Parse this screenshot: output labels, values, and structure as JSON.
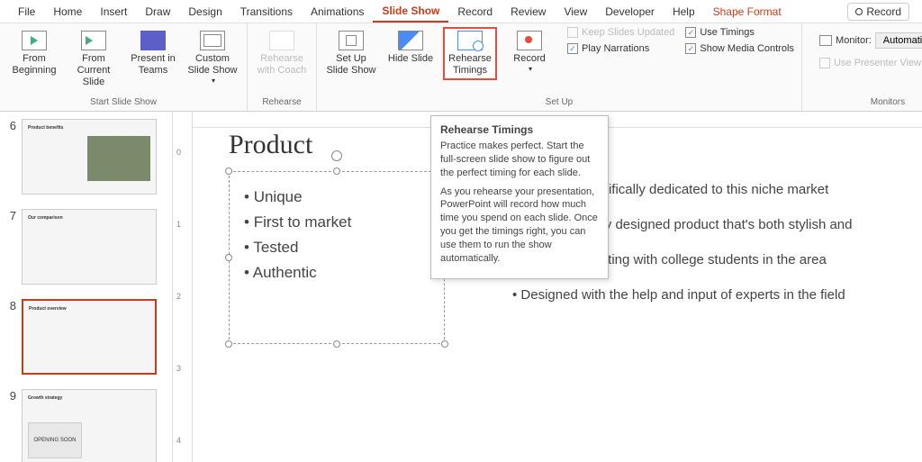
{
  "menu": {
    "tabs": [
      "File",
      "Home",
      "Insert",
      "Draw",
      "Design",
      "Transitions",
      "Animations",
      "Slide Show",
      "Record",
      "Review",
      "View",
      "Developer",
      "Help",
      "Shape Format"
    ],
    "active": "Slide Show",
    "record": "Record"
  },
  "ribbon": {
    "groups": {
      "start": {
        "label": "Start Slide Show"
      },
      "rehearse_grp": {
        "label": "Rehearse"
      },
      "setup": {
        "label": "Set Up"
      },
      "monitors": {
        "label": "Monitors"
      }
    },
    "buttons": {
      "from_beginning": "From Beginning",
      "from_current": "From Current Slide",
      "present_teams": "Present in Teams",
      "custom_show": "Custom Slide Show",
      "rehearse_coach": "Rehearse with Coach",
      "setup_show": "Set Up Slide Show",
      "hide_slide": "Hide Slide",
      "rehearse_timings": "Rehearse Timings",
      "record": "Record"
    },
    "checks": {
      "keep_updated": "Keep Slides Updated",
      "play_narr": "Play Narrations",
      "use_timings": "Use Timings",
      "show_media": "Show Media Controls",
      "use_presenter": "Use Presenter View"
    },
    "monitor": {
      "label": "Monitor:",
      "value": "Automatic"
    }
  },
  "tooltip": {
    "title": "Rehearse Timings",
    "p1": "Practice makes perfect. Start the full-screen slide show to figure out the perfect timing for each slide.",
    "p2": "As you rehearse your presentation, PowerPoint will record how much time you spend on each slide. Once you get the timings right, you can use them to run the show automatically."
  },
  "thumbs": [
    {
      "num": "6",
      "title": "Product benefits"
    },
    {
      "num": "7",
      "title": "Our comparison"
    },
    {
      "num": "8",
      "title": "Product overview"
    },
    {
      "num": "9",
      "title": "Growth strategy"
    }
  ],
  "slide": {
    "title": "Product",
    "left": [
      "Unique",
      "First to market",
      "Tested",
      "Authentic"
    ],
    "right": [
      "y product specifically dedicated to this niche market",
      "First beautifully designed product that's both stylish and",
      "Conducted testing with college students in the area",
      "Designed with the help and input of experts in the field"
    ]
  },
  "ruler_v": [
    "0",
    "",
    "1",
    "",
    "2",
    "",
    "3",
    "",
    "4"
  ]
}
